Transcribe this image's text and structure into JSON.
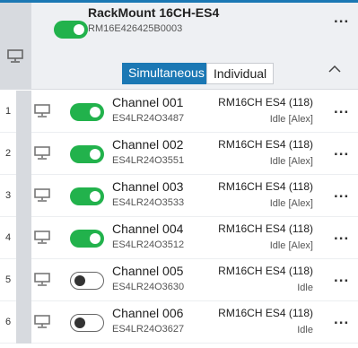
{
  "device": {
    "name": "RackMount 16CH-ES4",
    "serial": "RM16E426425B0003",
    "enabled": true,
    "more_label": "...",
    "modes": [
      "Simultaneous",
      "Individual"
    ],
    "active_mode": "Simultaneous"
  },
  "channels": [
    {
      "num": "1",
      "name": "Channel 001",
      "serial": "ES4LR24O3487",
      "model": "RM16CH ES4 (118)",
      "status": "Idle [Alex]",
      "enabled": true
    },
    {
      "num": "2",
      "name": "Channel 002",
      "serial": "ES4LR24O3551",
      "model": "RM16CH ES4 (118)",
      "status": "Idle [Alex]",
      "enabled": true
    },
    {
      "num": "3",
      "name": "Channel 003",
      "serial": "ES4LR24O3533",
      "model": "RM16CH ES4 (118)",
      "status": "Idle [Alex]",
      "enabled": true
    },
    {
      "num": "4",
      "name": "Channel 004",
      "serial": "ES4LR24O3512",
      "model": "RM16CH ES4 (118)",
      "status": "Idle [Alex]",
      "enabled": true
    },
    {
      "num": "5",
      "name": "Channel 005",
      "serial": "ES4LR24O3630",
      "model": "RM16CH ES4 (118)",
      "status": "Idle",
      "enabled": false
    },
    {
      "num": "6",
      "name": "Channel 006",
      "serial": "ES4LR24O3627",
      "model": "RM16CH ES4 (118)",
      "status": "Idle",
      "enabled": false
    }
  ],
  "colors": {
    "accent": "#1b78b4",
    "toggle_on": "#22b24c"
  }
}
